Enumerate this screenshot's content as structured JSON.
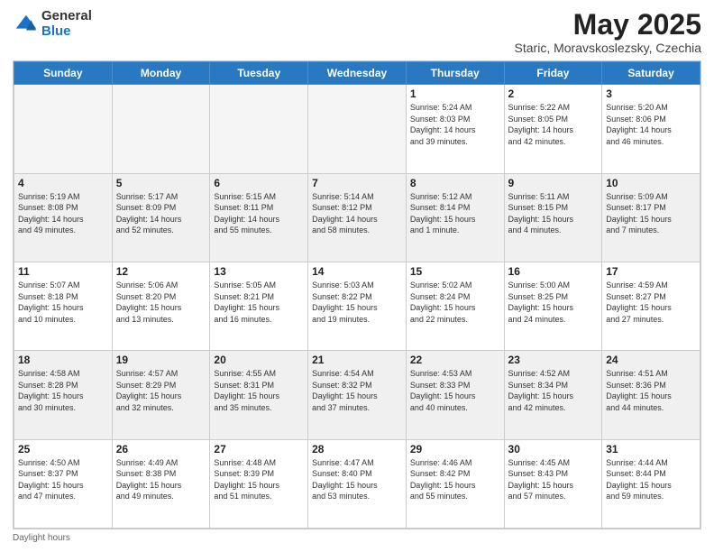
{
  "logo": {
    "general": "General",
    "blue": "Blue"
  },
  "header": {
    "month": "May 2025",
    "location": "Staric, Moravskoslezsky, Czechia"
  },
  "days": [
    "Sunday",
    "Monday",
    "Tuesday",
    "Wednesday",
    "Thursday",
    "Friday",
    "Saturday"
  ],
  "weeks": [
    [
      {
        "day": "",
        "info": ""
      },
      {
        "day": "",
        "info": ""
      },
      {
        "day": "",
        "info": ""
      },
      {
        "day": "",
        "info": ""
      },
      {
        "day": "1",
        "info": "Sunrise: 5:24 AM\nSunset: 8:03 PM\nDaylight: 14 hours\nand 39 minutes."
      },
      {
        "day": "2",
        "info": "Sunrise: 5:22 AM\nSunset: 8:05 PM\nDaylight: 14 hours\nand 42 minutes."
      },
      {
        "day": "3",
        "info": "Sunrise: 5:20 AM\nSunset: 8:06 PM\nDaylight: 14 hours\nand 46 minutes."
      }
    ],
    [
      {
        "day": "4",
        "info": "Sunrise: 5:19 AM\nSunset: 8:08 PM\nDaylight: 14 hours\nand 49 minutes."
      },
      {
        "day": "5",
        "info": "Sunrise: 5:17 AM\nSunset: 8:09 PM\nDaylight: 14 hours\nand 52 minutes."
      },
      {
        "day": "6",
        "info": "Sunrise: 5:15 AM\nSunset: 8:11 PM\nDaylight: 14 hours\nand 55 minutes."
      },
      {
        "day": "7",
        "info": "Sunrise: 5:14 AM\nSunset: 8:12 PM\nDaylight: 14 hours\nand 58 minutes."
      },
      {
        "day": "8",
        "info": "Sunrise: 5:12 AM\nSunset: 8:14 PM\nDaylight: 15 hours\nand 1 minute."
      },
      {
        "day": "9",
        "info": "Sunrise: 5:11 AM\nSunset: 8:15 PM\nDaylight: 15 hours\nand 4 minutes."
      },
      {
        "day": "10",
        "info": "Sunrise: 5:09 AM\nSunset: 8:17 PM\nDaylight: 15 hours\nand 7 minutes."
      }
    ],
    [
      {
        "day": "11",
        "info": "Sunrise: 5:07 AM\nSunset: 8:18 PM\nDaylight: 15 hours\nand 10 minutes."
      },
      {
        "day": "12",
        "info": "Sunrise: 5:06 AM\nSunset: 8:20 PM\nDaylight: 15 hours\nand 13 minutes."
      },
      {
        "day": "13",
        "info": "Sunrise: 5:05 AM\nSunset: 8:21 PM\nDaylight: 15 hours\nand 16 minutes."
      },
      {
        "day": "14",
        "info": "Sunrise: 5:03 AM\nSunset: 8:22 PM\nDaylight: 15 hours\nand 19 minutes."
      },
      {
        "day": "15",
        "info": "Sunrise: 5:02 AM\nSunset: 8:24 PM\nDaylight: 15 hours\nand 22 minutes."
      },
      {
        "day": "16",
        "info": "Sunrise: 5:00 AM\nSunset: 8:25 PM\nDaylight: 15 hours\nand 24 minutes."
      },
      {
        "day": "17",
        "info": "Sunrise: 4:59 AM\nSunset: 8:27 PM\nDaylight: 15 hours\nand 27 minutes."
      }
    ],
    [
      {
        "day": "18",
        "info": "Sunrise: 4:58 AM\nSunset: 8:28 PM\nDaylight: 15 hours\nand 30 minutes."
      },
      {
        "day": "19",
        "info": "Sunrise: 4:57 AM\nSunset: 8:29 PM\nDaylight: 15 hours\nand 32 minutes."
      },
      {
        "day": "20",
        "info": "Sunrise: 4:55 AM\nSunset: 8:31 PM\nDaylight: 15 hours\nand 35 minutes."
      },
      {
        "day": "21",
        "info": "Sunrise: 4:54 AM\nSunset: 8:32 PM\nDaylight: 15 hours\nand 37 minutes."
      },
      {
        "day": "22",
        "info": "Sunrise: 4:53 AM\nSunset: 8:33 PM\nDaylight: 15 hours\nand 40 minutes."
      },
      {
        "day": "23",
        "info": "Sunrise: 4:52 AM\nSunset: 8:34 PM\nDaylight: 15 hours\nand 42 minutes."
      },
      {
        "day": "24",
        "info": "Sunrise: 4:51 AM\nSunset: 8:36 PM\nDaylight: 15 hours\nand 44 minutes."
      }
    ],
    [
      {
        "day": "25",
        "info": "Sunrise: 4:50 AM\nSunset: 8:37 PM\nDaylight: 15 hours\nand 47 minutes."
      },
      {
        "day": "26",
        "info": "Sunrise: 4:49 AM\nSunset: 8:38 PM\nDaylight: 15 hours\nand 49 minutes."
      },
      {
        "day": "27",
        "info": "Sunrise: 4:48 AM\nSunset: 8:39 PM\nDaylight: 15 hours\nand 51 minutes."
      },
      {
        "day": "28",
        "info": "Sunrise: 4:47 AM\nSunset: 8:40 PM\nDaylight: 15 hours\nand 53 minutes."
      },
      {
        "day": "29",
        "info": "Sunrise: 4:46 AM\nSunset: 8:42 PM\nDaylight: 15 hours\nand 55 minutes."
      },
      {
        "day": "30",
        "info": "Sunrise: 4:45 AM\nSunset: 8:43 PM\nDaylight: 15 hours\nand 57 minutes."
      },
      {
        "day": "31",
        "info": "Sunrise: 4:44 AM\nSunset: 8:44 PM\nDaylight: 15 hours\nand 59 minutes."
      }
    ]
  ],
  "footer": {
    "daylight_label": "Daylight hours"
  }
}
